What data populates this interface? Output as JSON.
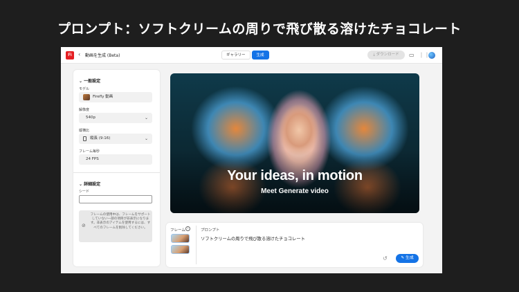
{
  "slide": {
    "title": "プロンプト：ソフトクリームの周りで飛び散る溶けたチョコレート"
  },
  "topbar": {
    "logo": "Fi",
    "back_icon": "chevron-left-icon",
    "title": "動画を生成 (Beta)",
    "tabs": [
      {
        "label": "ギャラリー",
        "active": false
      },
      {
        "label": "生成",
        "active": true
      }
    ],
    "download_label": "⤓ ダウンロード",
    "icons": [
      "comment-icon",
      "apps-grid-icon",
      "user-avatar-icon"
    ]
  },
  "panel": {
    "general": {
      "heading": "一般設定",
      "model_label": "モデル",
      "model_value": "Firefly 動画",
      "resolution_label": "解像度",
      "resolution_value": "540p",
      "aspect_label": "縦横比",
      "aspect_value": "縦長 (9:16)",
      "fps_label": "フレーム毎秒",
      "fps_value": "24 FPS"
    },
    "advanced": {
      "heading": "詳細設定",
      "seed_label": "シード",
      "seed_value": "",
      "notice_text": "フレームの使用中は、フレームをサポートしていない一部の項目が非表示になります。非表示のアイテムを使用するには、すべてのフレームを削除してください。"
    }
  },
  "preview": {
    "title": "Your ideas, in motion",
    "subtitle": "Meet Generate video"
  },
  "prompt": {
    "frame_label": "フレーム",
    "prompt_label": "プロンプト",
    "prompt_text": "ソフトクリームの周りで飛び散る溶けたチョコレート",
    "generate_label": "生成",
    "undo_icon": "undo-icon"
  },
  "colors": {
    "accent": "#1473e6",
    "brand": "#e51f23",
    "background": "#1e1e1e"
  }
}
